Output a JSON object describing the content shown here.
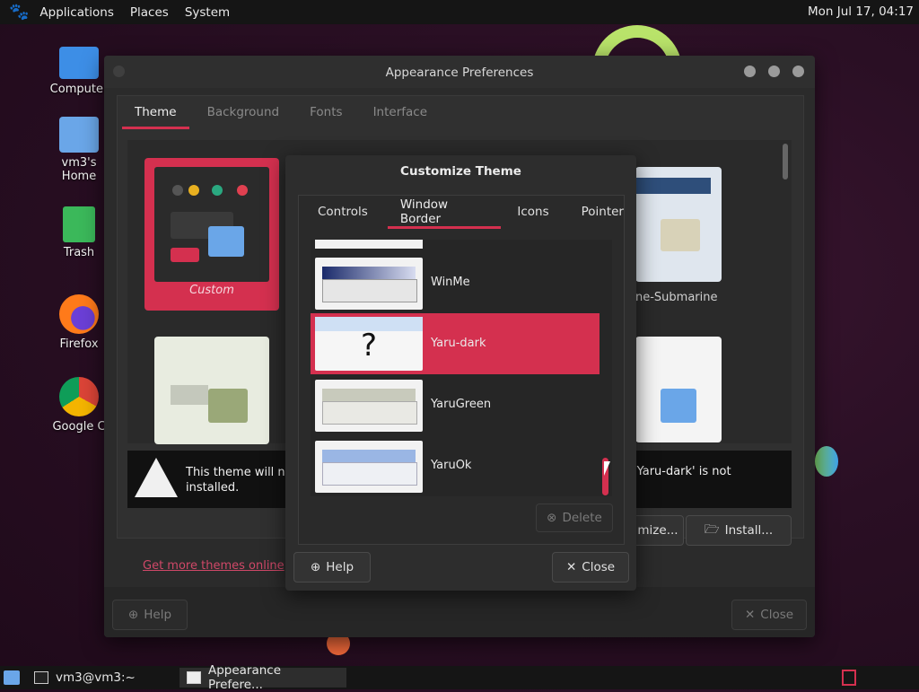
{
  "top_panel": {
    "menus": [
      "Applications",
      "Places",
      "System"
    ],
    "clock": "Mon Jul 17, 04:17"
  },
  "desktop_icons": [
    {
      "label": "Computer",
      "icon": "computer-icon"
    },
    {
      "label": "vm3's Home",
      "icon": "home-folder-icon"
    },
    {
      "label": "Trash",
      "icon": "trash-icon"
    },
    {
      "label": "Firefox",
      "icon": "firefox-icon"
    },
    {
      "label": "Google C",
      "icon": "chrome-icon"
    }
  ],
  "appearance": {
    "title": "Appearance Preferences",
    "tabs": [
      "Theme",
      "Background",
      "Fonts",
      "Interface"
    ],
    "active_tab": "Theme",
    "themes": [
      {
        "label": "Custom",
        "selected": true
      },
      {
        "label": "ne-Submarine"
      }
    ],
    "warning_left": "This theme will no\ninstalled.",
    "warning_right": "'Yaru-dark' is not",
    "customize_label": "mize...",
    "install_label": "Install...",
    "get_more_link": "Get more themes online",
    "help_label": "Help",
    "close_label": "Close"
  },
  "customize": {
    "title": "Customize Theme",
    "tabs": [
      "Controls",
      "Window Border",
      "Icons",
      "Pointer"
    ],
    "active_tab": "Window Border",
    "items": [
      {
        "label": "WinMe",
        "selected": false
      },
      {
        "label": "Yaru-dark",
        "selected": true,
        "preview_glyph": "?"
      },
      {
        "label": "YaruGreen",
        "selected": false
      },
      {
        "label": "YaruOk",
        "selected": false
      }
    ],
    "delete_label": "Delete",
    "help_label": "Help",
    "close_label": "Close"
  },
  "taskbar": [
    {
      "label": "vm3@vm3:~",
      "icon": "terminal-icon"
    },
    {
      "label": "Appearance Prefere...",
      "icon": "window-icon",
      "active": true
    }
  ],
  "theme_colors": {
    "accent": "#d4304f",
    "window_bg": "#2b2b2b",
    "panel_bg": "#151515"
  }
}
